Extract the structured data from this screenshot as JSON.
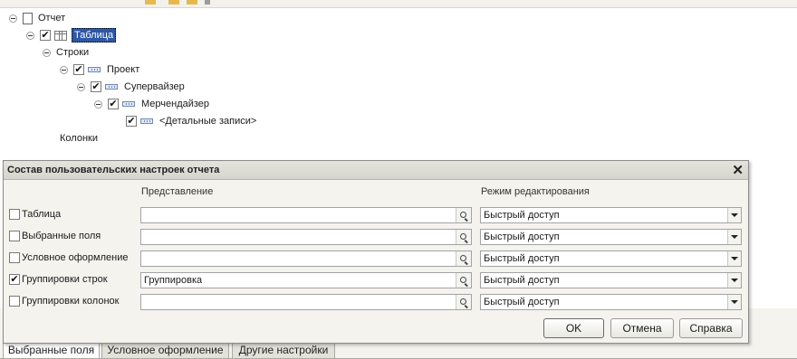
{
  "tree": {
    "root_label": "Отчет",
    "table_label": "Таблица",
    "rows_label": "Строки",
    "project_label": "Проект",
    "supervisor_label": "Супервайзер",
    "merchandiser_label": "Мерчендайзер",
    "details_label": "<Детальные записи>",
    "columns_label": "Колонки"
  },
  "dialog": {
    "title": "Состав пользовательских настроек отчета",
    "close_glyph": "✕",
    "col_presentation": "Представление",
    "col_edit_mode": "Режим редактирования",
    "rows": [
      {
        "label": "Таблица",
        "checked": false,
        "presentation": "",
        "mode": "Быстрый доступ"
      },
      {
        "label": "Выбранные поля",
        "checked": false,
        "presentation": "",
        "mode": "Быстрый доступ"
      },
      {
        "label": "Условное оформление",
        "checked": false,
        "presentation": "",
        "mode": "Быстрый доступ"
      },
      {
        "label": "Группировки строк",
        "checked": true,
        "presentation": "Группировка",
        "mode": "Быстрый доступ"
      },
      {
        "label": "Группировки колонок",
        "checked": false,
        "presentation": "",
        "mode": "Быстрый доступ"
      }
    ],
    "ok_label": "OK",
    "cancel_label": "Отмена",
    "help_label": "Справка"
  },
  "tabs": [
    "Выбранные поля",
    "Условное оформление",
    "Другие настройки"
  ],
  "check_glyph": "✔"
}
